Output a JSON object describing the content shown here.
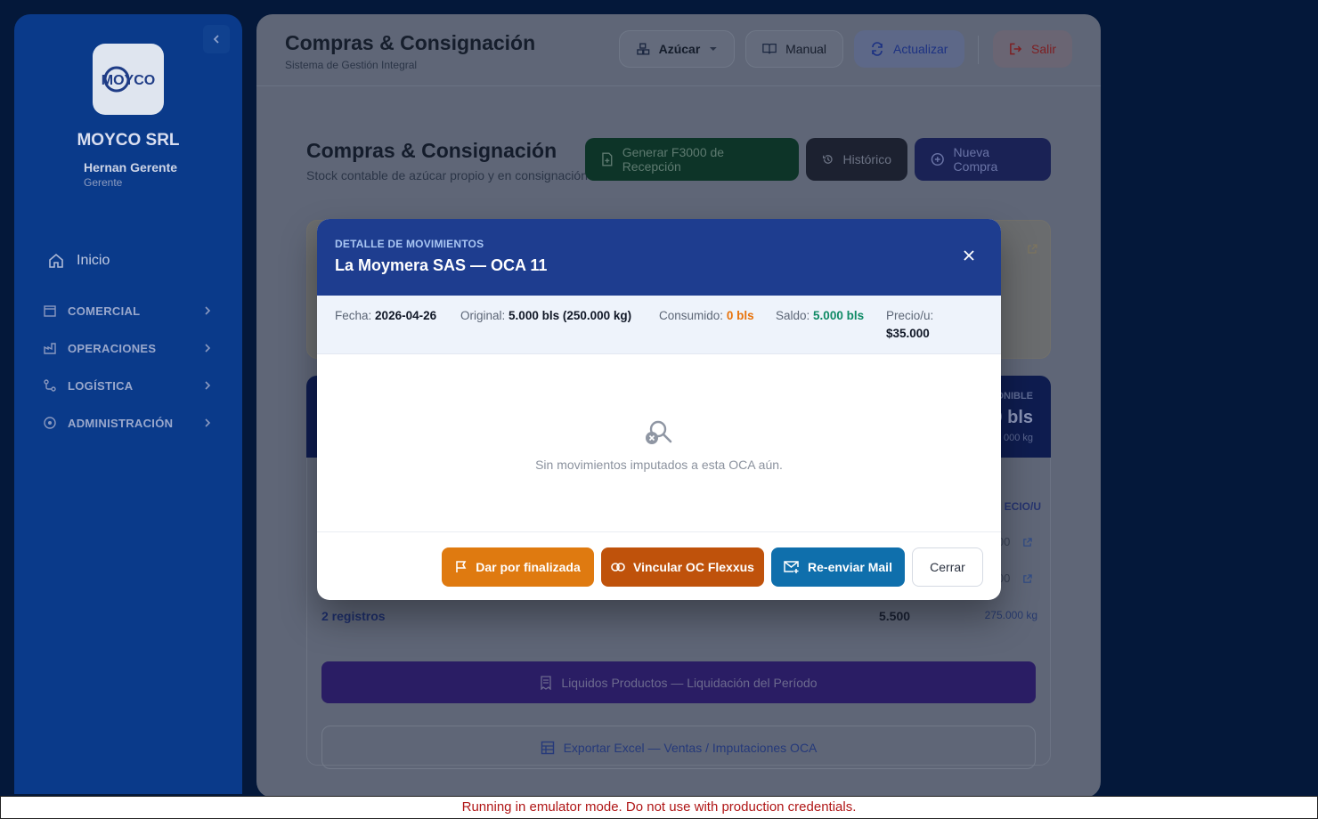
{
  "sidebar": {
    "company": "MOYCO SRL",
    "logo_text": "MOYCO",
    "user_name": "Hernan Gerente",
    "user_role": "Gerente",
    "home_label": "Inicio",
    "groups": [
      {
        "label": "COMERCIAL",
        "icon": "store-icon"
      },
      {
        "label": "OPERACIONES",
        "icon": "factory-icon"
      },
      {
        "label": "LOGÍSTICA",
        "icon": "route-icon"
      },
      {
        "label": "ADMINISTRACIÓN",
        "icon": "admin-icon"
      }
    ]
  },
  "topbar": {
    "title": "Compras & Consignación",
    "subtitle": "Sistema de Gestión Integral",
    "product_select": "Azúcar",
    "manual_label": "Manual",
    "refresh_label": "Actualizar",
    "logout_label": "Salir"
  },
  "page": {
    "title": "Compras & Consignación",
    "subtitle": "Stock contable de azúcar propio y en consignación",
    "btn_f3000": "Generar F3000 de Recepción",
    "btn_historico": "Histórico",
    "btn_nueva": "Nueva Compra",
    "stat_label_partial": "ONIBLE",
    "stat_value_partial": "0 bls",
    "stat_sub_partial": "000 kg",
    "col_header_partial": "ECIO/U",
    "row1_partial": "000",
    "row2_partial": "000",
    "registros": "2 registros",
    "total_bls": "5.500",
    "total_kg": "275.000 kg",
    "liquidos_label": "Liquidos Productos — Liquidación del Período",
    "export_label": "Exportar Excel — Ventas / Imputaciones OCA"
  },
  "modal": {
    "kicker": "DETALLE DE MOVIMIENTOS",
    "title": "La Moymera SAS — OCA 11",
    "fecha_label": "Fecha:",
    "fecha_value": "2026-04-26",
    "original_label": "Original:",
    "original_value": "5.000 bls (250.000 kg)",
    "consumido_label": "Consumido:",
    "consumido_value": "0 bls",
    "saldo_label": "Saldo:",
    "saldo_value": "5.000 bls",
    "precio_label": "Precio/u:",
    "precio_value": "$35.000",
    "empty_message": "Sin movimientos imputados a esta OCA aún.",
    "btn_finalizar": "Dar por finalizada",
    "btn_vincular": "Vincular OC Flexxus",
    "btn_reenviar": "Re-enviar Mail",
    "btn_cerrar": "Cerrar"
  },
  "colors": {
    "sidebar_bg": "#0a3a8a",
    "modal_header": "#1e3d8f",
    "orange": "#df7a10",
    "dark_orange": "#bf520b",
    "blue_button": "#0f6fac",
    "saldo_green": "#0f8a65"
  },
  "footer_notice": "Running in emulator mode. Do not use with production credentials."
}
